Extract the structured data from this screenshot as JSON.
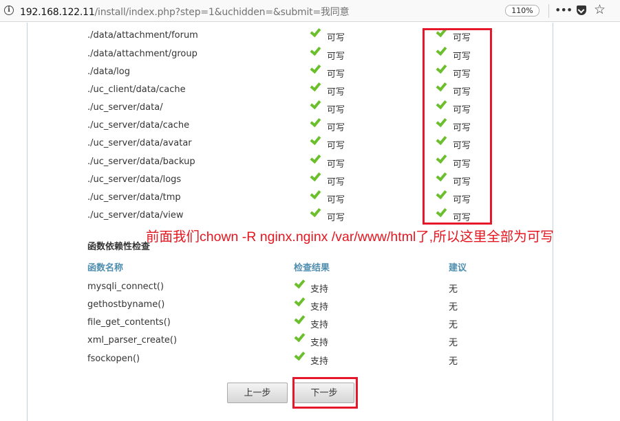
{
  "browser": {
    "url_host": "192.168.122.11",
    "url_path": "/install/index.php?step=1&uchidden=&submit=我同意",
    "zoom": "110%",
    "more": "•••"
  },
  "dirs": [
    {
      "path": "./data/attachment/forum",
      "current": "可写",
      "required": "可写"
    },
    {
      "path": "./data/attachment/group",
      "current": "可写",
      "required": "可写"
    },
    {
      "path": "./data/log",
      "current": "可写",
      "required": "可写"
    },
    {
      "path": "./uc_client/data/cache",
      "current": "可写",
      "required": "可写"
    },
    {
      "path": "./uc_server/data/",
      "current": "可写",
      "required": "可写"
    },
    {
      "path": "./uc_server/data/cache",
      "current": "可写",
      "required": "可写"
    },
    {
      "path": "./uc_server/data/avatar",
      "current": "可写",
      "required": "可写"
    },
    {
      "path": "./uc_server/data/backup",
      "current": "可写",
      "required": "可写"
    },
    {
      "path": "./uc_server/data/logs",
      "current": "可写",
      "required": "可写"
    },
    {
      "path": "./uc_server/data/tmp",
      "current": "可写",
      "required": "可写"
    },
    {
      "path": "./uc_server/data/view",
      "current": "可写",
      "required": "可写"
    }
  ],
  "functions": {
    "title": "函数依赖性检查",
    "headers": {
      "name": "函数名称",
      "result": "检查结果",
      "advice": "建议"
    },
    "rows": [
      {
        "name": "mysqli_connect()",
        "result": "支持",
        "advice": "无"
      },
      {
        "name": "gethostbyname()",
        "result": "支持",
        "advice": "无"
      },
      {
        "name": "file_get_contents()",
        "result": "支持",
        "advice": "无"
      },
      {
        "name": "xml_parser_create()",
        "result": "支持",
        "advice": "无"
      },
      {
        "name": "fsockopen()",
        "result": "支持",
        "advice": "无"
      }
    ]
  },
  "buttons": {
    "prev": "上一步",
    "next": "下一步"
  },
  "annotation": "前面我们chown -R nginx.nginx /var/www/html了,所以这里全部为可写",
  "colors": {
    "annotation": "#e4161f",
    "check": "#6cbf2c",
    "header": "#4f8eae"
  }
}
